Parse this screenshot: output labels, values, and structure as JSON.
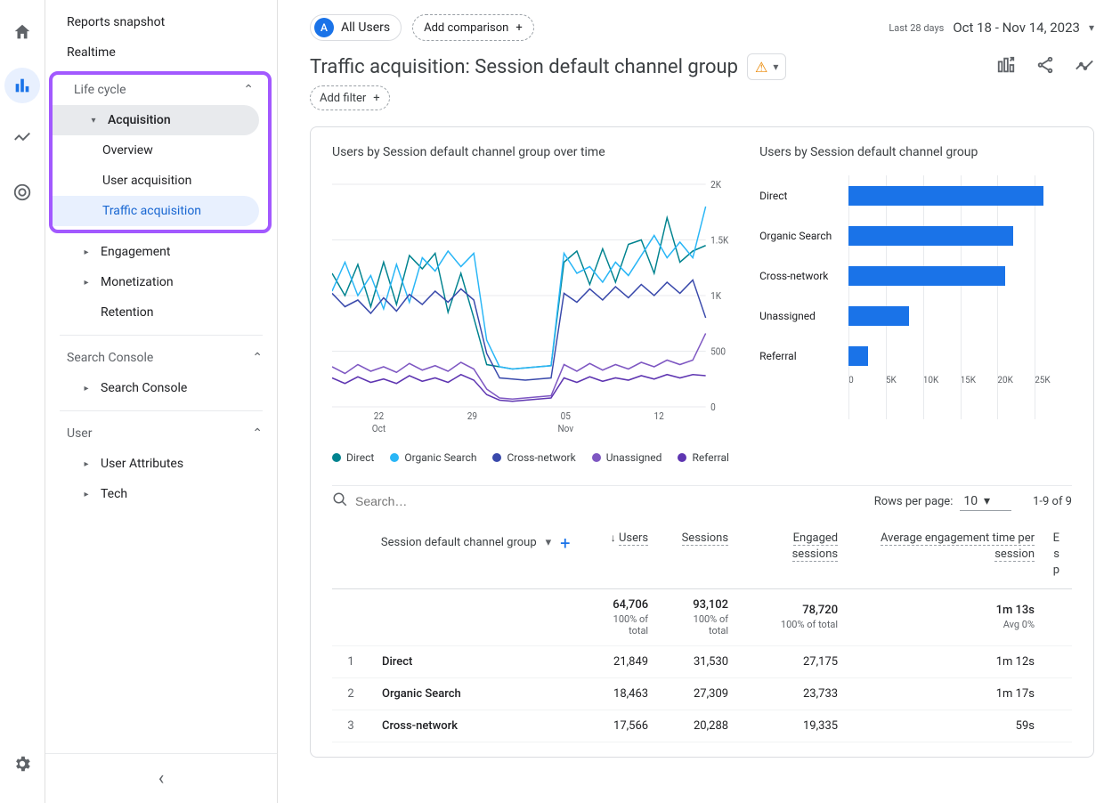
{
  "rail": {
    "items": [
      "home",
      "reports",
      "explore",
      "advertising"
    ]
  },
  "sidebar": {
    "top": [
      {
        "label": "Reports snapshot"
      },
      {
        "label": "Realtime"
      }
    ],
    "lifecycle_label": "Life cycle",
    "acquisition_label": "Acquisition",
    "acq_children": [
      {
        "label": "Overview"
      },
      {
        "label": "User acquisition"
      },
      {
        "label": "Traffic acquisition",
        "active": true
      }
    ],
    "other_lifecycle": [
      {
        "label": "Engagement"
      },
      {
        "label": "Monetization"
      },
      {
        "label": "Retention",
        "no_caret": true
      }
    ],
    "search_console_group": "Search Console",
    "search_console_item": "Search Console",
    "user_group": "User",
    "user_items": [
      {
        "label": "User Attributes"
      },
      {
        "label": "Tech"
      }
    ]
  },
  "header": {
    "all_users_badge": "A",
    "all_users": "All Users",
    "add_comparison": "Add comparison",
    "date_prefix": "Last 28 days",
    "date_range": "Oct 18 - Nov 14, 2023"
  },
  "title": "Traffic acquisition: Session default channel group",
  "add_filter": "Add filter",
  "chart_left_title": "Users by Session default channel group over time",
  "chart_right_title": "Users by Session default channel group",
  "chart_data": {
    "line": {
      "type": "line",
      "title": "Users by Session default channel group over time",
      "ylabel": "Users",
      "ylim": [
        0,
        2000
      ],
      "y_ticks": [
        "0",
        "500",
        "1K",
        "1.5K",
        "2K"
      ],
      "x_ticks": [
        {
          "label_top": "22",
          "label_bot": "Oct"
        },
        {
          "label_top": "29",
          "label_bot": ""
        },
        {
          "label_top": "05",
          "label_bot": "Nov"
        },
        {
          "label_top": "12",
          "label_bot": ""
        }
      ],
      "series": [
        {
          "name": "Direct",
          "color": "#00838f",
          "values": [
            1200,
            1000,
            1280,
            900,
            1300,
            920,
            1360,
            1240,
            1380,
            850,
            1200,
            800,
            380,
            360,
            340,
            350,
            360,
            370,
            1300,
            1400,
            1100,
            1420,
            1120,
            1460,
            1500,
            1200,
            1700,
            1300,
            1400,
            1450
          ]
        },
        {
          "name": "Organic Search",
          "color": "#29b6f6",
          "values": [
            1040,
            1300,
            1000,
            1180,
            880,
            1280,
            940,
            1340,
            1220,
            1400,
            1260,
            1380,
            600,
            360,
            340,
            350,
            360,
            370,
            1380,
            1200,
            1260,
            1120,
            1300,
            1180,
            1360,
            1540,
            1340,
            1480,
            1340,
            1800
          ]
        },
        {
          "name": "Cross-network",
          "color": "#3949ab",
          "values": [
            1020,
            900,
            960,
            840,
            980,
            860,
            1010,
            920,
            1040,
            940,
            1060,
            960,
            480,
            260,
            250,
            240,
            250,
            260,
            1020,
            940,
            1060,
            960,
            1080,
            980,
            1100,
            1000,
            1120,
            1020,
            1140,
            800
          ]
        },
        {
          "name": "Unassigned",
          "color": "#7e57c2",
          "values": [
            360,
            300,
            380,
            320,
            360,
            310,
            390,
            330,
            370,
            320,
            400,
            340,
            160,
            80,
            70,
            80,
            90,
            100,
            380,
            320,
            390,
            330,
            380,
            340,
            400,
            360,
            420,
            380,
            420,
            660
          ]
        },
        {
          "name": "Referral",
          "color": "#5e35b1",
          "values": [
            260,
            210,
            270,
            220,
            250,
            210,
            280,
            230,
            260,
            220,
            290,
            240,
            110,
            60,
            50,
            60,
            70,
            80,
            260,
            220,
            270,
            230,
            260,
            240,
            280,
            250,
            290,
            260,
            290,
            280
          ]
        }
      ]
    },
    "bar": {
      "type": "bar",
      "title": "Users by Session default channel group",
      "x_ticks": [
        "0",
        "5K",
        "10K",
        "15K",
        "20K",
        "25K"
      ],
      "xmax": 25000,
      "categories": [
        "Direct",
        "Organic Search",
        "Cross-network",
        "Unassigned",
        "Referral"
      ],
      "values": [
        21849,
        18463,
        17566,
        6800,
        2200
      ]
    }
  },
  "legend": [
    "Direct",
    "Organic Search",
    "Cross-network",
    "Unassigned",
    "Referral"
  ],
  "legend_colors": [
    "#00838f",
    "#29b6f6",
    "#3949ab",
    "#7e57c2",
    "#5e35b1"
  ],
  "table": {
    "search_placeholder": "Search…",
    "rows_per_label": "Rows per page:",
    "rows_per_value": "10",
    "pager": "1-9 of 9",
    "dim_label": "Session default channel group",
    "columns": [
      "Users",
      "Sessions",
      "Engaged sessions",
      "Average engagement time per session",
      "E"
    ],
    "col5_line2": "s",
    "col5_line3": "p",
    "totals": {
      "users": "64,706",
      "users_sub": "100% of total",
      "sessions": "93,102",
      "sessions_sub": "100% of total",
      "engaged": "78,720",
      "engaged_sub": "100% of total",
      "avg": "1m 13s",
      "avg_sub": "Avg 0%"
    },
    "rows": [
      {
        "idx": "1",
        "name": "Direct",
        "users": "21,849",
        "sessions": "31,530",
        "engaged": "27,175",
        "avg": "1m 12s"
      },
      {
        "idx": "2",
        "name": "Organic Search",
        "users": "18,463",
        "sessions": "27,309",
        "engaged": "23,733",
        "avg": "1m 17s"
      },
      {
        "idx": "3",
        "name": "Cross-network",
        "users": "17,566",
        "sessions": "20,288",
        "engaged": "19,335",
        "avg": "59s"
      }
    ]
  }
}
